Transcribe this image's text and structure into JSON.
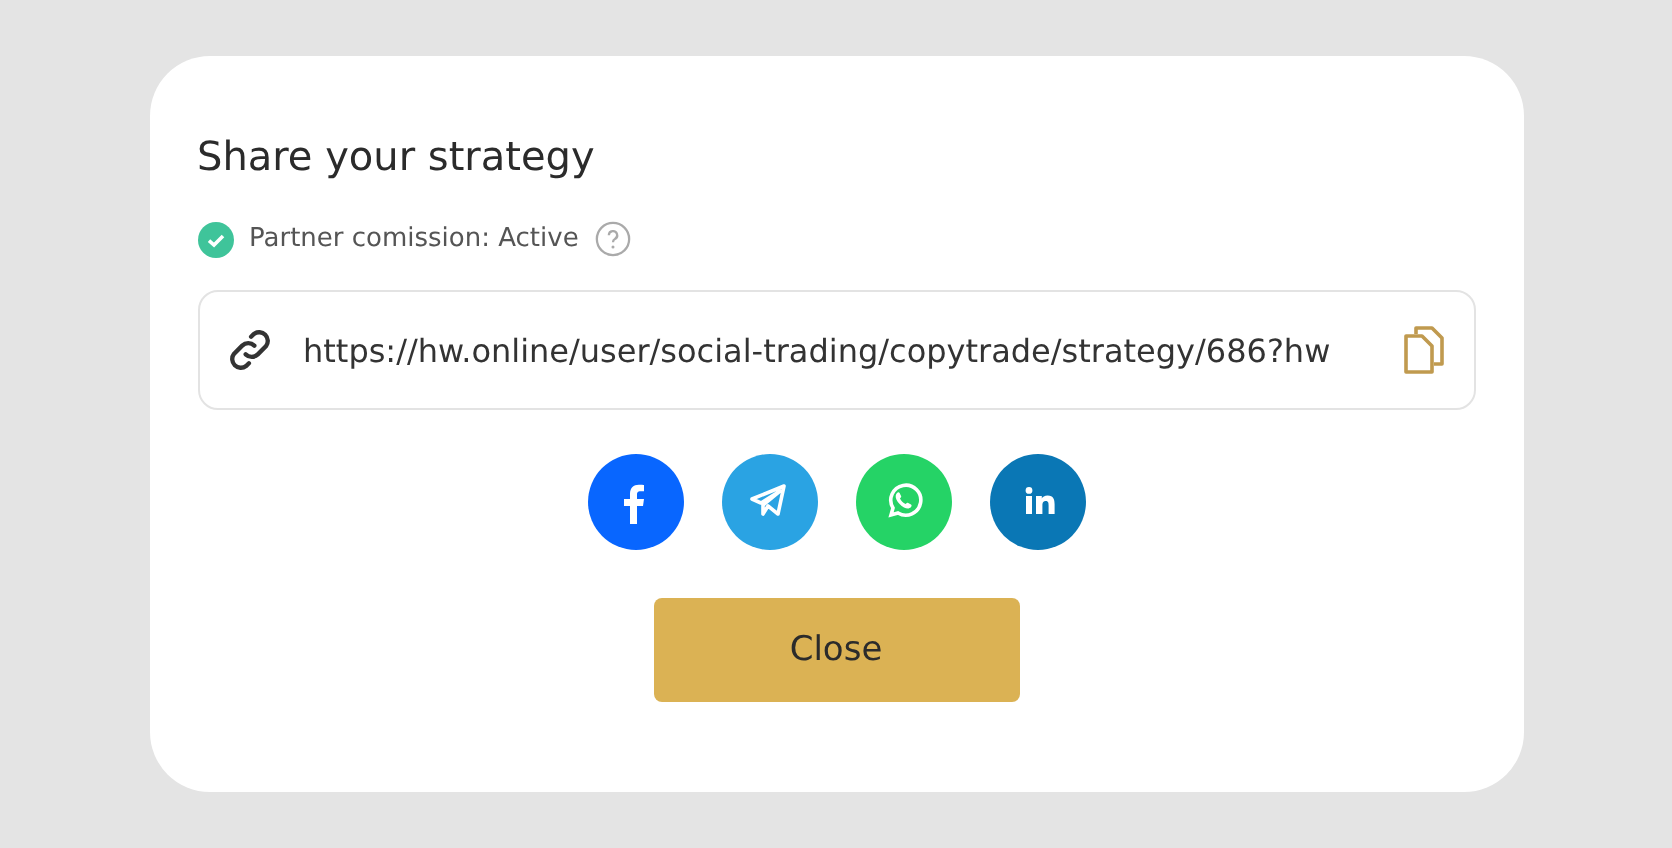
{
  "dialog": {
    "title": "Share your strategy",
    "status": {
      "label": "Partner comission: Active",
      "active": true
    },
    "link": {
      "value": "https://hw.online/user/social-trading/copytrade/strategy/686?hw"
    },
    "share_buttons": [
      {
        "kind": "facebook",
        "color": "#0866ff"
      },
      {
        "kind": "telegram",
        "color": "#2aa3e3"
      },
      {
        "kind": "whatsapp",
        "color": "#25d366"
      },
      {
        "kind": "linkedin",
        "color": "#0a77b5"
      }
    ],
    "close_button": "Close"
  }
}
